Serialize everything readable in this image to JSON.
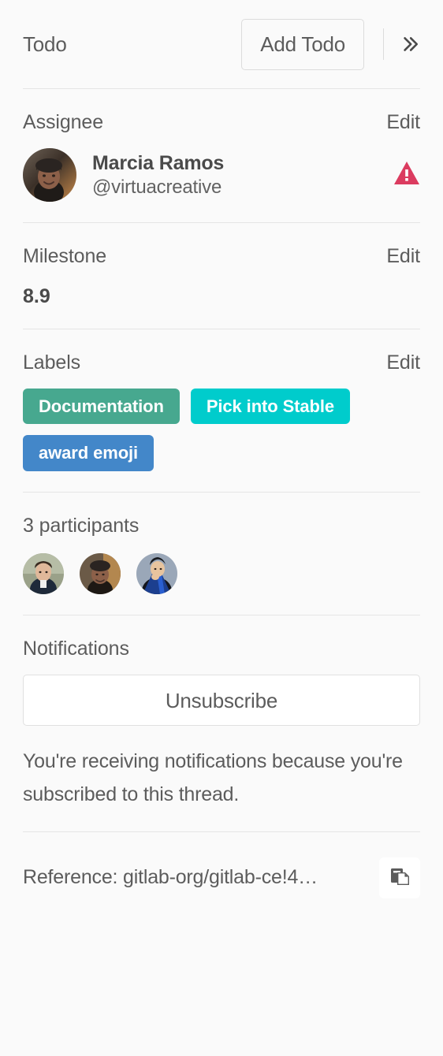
{
  "sidebar": {
    "todo": {
      "label": "Todo",
      "add_button": "Add Todo",
      "collapse_icon": "chevron-double-right-icon"
    },
    "assignee": {
      "title": "Assignee",
      "edit": "Edit",
      "name": "Marcia Ramos",
      "username": "@virtuacreative",
      "warning_icon": "warning-triangle-icon",
      "warning_color": "#db3b5f",
      "avatar_icon": "user-avatar"
    },
    "milestone": {
      "title": "Milestone",
      "edit": "Edit",
      "value": "8.9"
    },
    "labels": {
      "title": "Labels",
      "edit": "Edit",
      "items": [
        {
          "name": "Documentation",
          "color": "#47a88f"
        },
        {
          "name": "Pick into Stable",
          "color": "#00cccc"
        },
        {
          "name": "award emoji",
          "color": "#4387c9"
        }
      ]
    },
    "participants": {
      "title": "3 participants",
      "count": 3,
      "avatars": [
        {
          "name": "participant-avatar-1"
        },
        {
          "name": "participant-avatar-2"
        },
        {
          "name": "participant-avatar-3"
        }
      ]
    },
    "notifications": {
      "title": "Notifications",
      "button": "Unsubscribe",
      "note": "You're receiving notifications because you're subscribed to this thread."
    },
    "reference": {
      "text": "Reference: gitlab-org/gitlab-ce!4…",
      "copy_icon": "copy-to-clipboard-icon"
    }
  }
}
